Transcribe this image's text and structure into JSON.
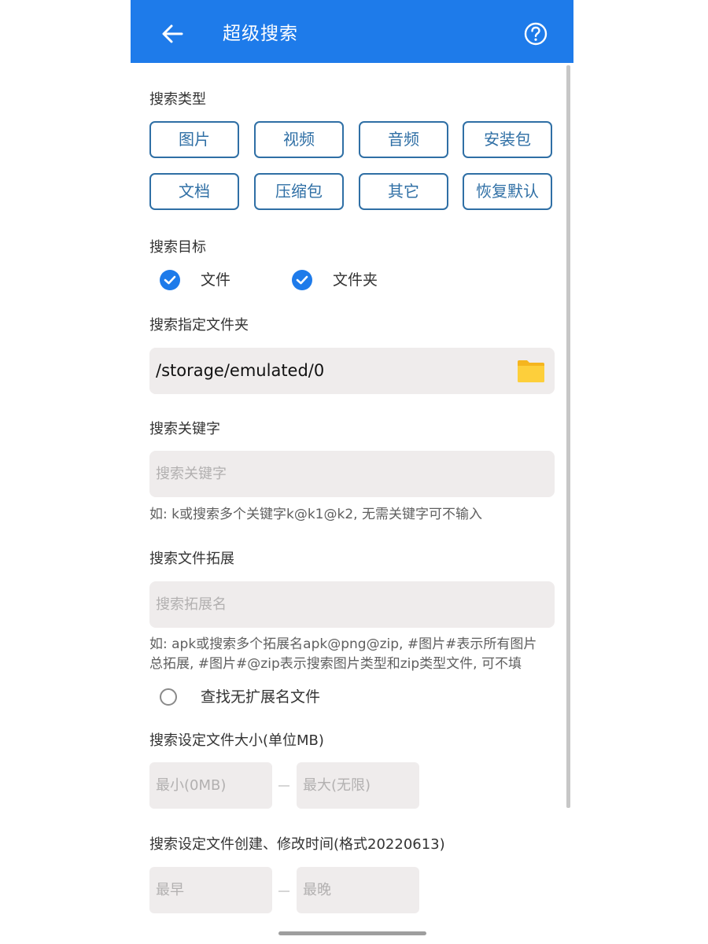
{
  "app_bar": {
    "title": "超级搜索",
    "back_icon": "arrow-left-icon",
    "help_icon": "question-circle-icon",
    "color": "#1e7bea"
  },
  "search_type": {
    "label": "搜索类型",
    "buttons": [
      "图片",
      "视频",
      "音频",
      "安装包",
      "文档",
      "压缩包",
      "其它",
      "恢复默认"
    ]
  },
  "search_target": {
    "label": "搜索目标",
    "options": [
      {
        "label": "文件",
        "checked": true
      },
      {
        "label": "文件夹",
        "checked": true
      }
    ]
  },
  "folder": {
    "label": "搜索指定文件夹",
    "path": "/storage/emulated/0",
    "icon": "folder-icon"
  },
  "keyword": {
    "label": "搜索关键字",
    "placeholder": "搜索关键字",
    "value": "",
    "hint": "如: k或搜索多个关键字k@k1@k2, 无需关键字可不输入"
  },
  "extension": {
    "label": "搜索文件拓展",
    "placeholder": "搜索拓展名",
    "value": "",
    "hint": "如: apk或搜索多个拓展名apk@png@zip, #图片#表示所有图片\n总拓展, #图片#@zip表示搜索图片类型和zip类型文件, 可不填",
    "no_ext_option": {
      "label": "查找无扩展名文件",
      "checked": false
    }
  },
  "size": {
    "label": "搜索设定文件大小(单位MB)",
    "min_placeholder": "最小(0MB)",
    "max_placeholder": "最大(无限)"
  },
  "time": {
    "label": "搜索设定文件创建、修改时间(格式20220613)",
    "earliest_placeholder": "最早",
    "latest_placeholder": "最晚"
  }
}
